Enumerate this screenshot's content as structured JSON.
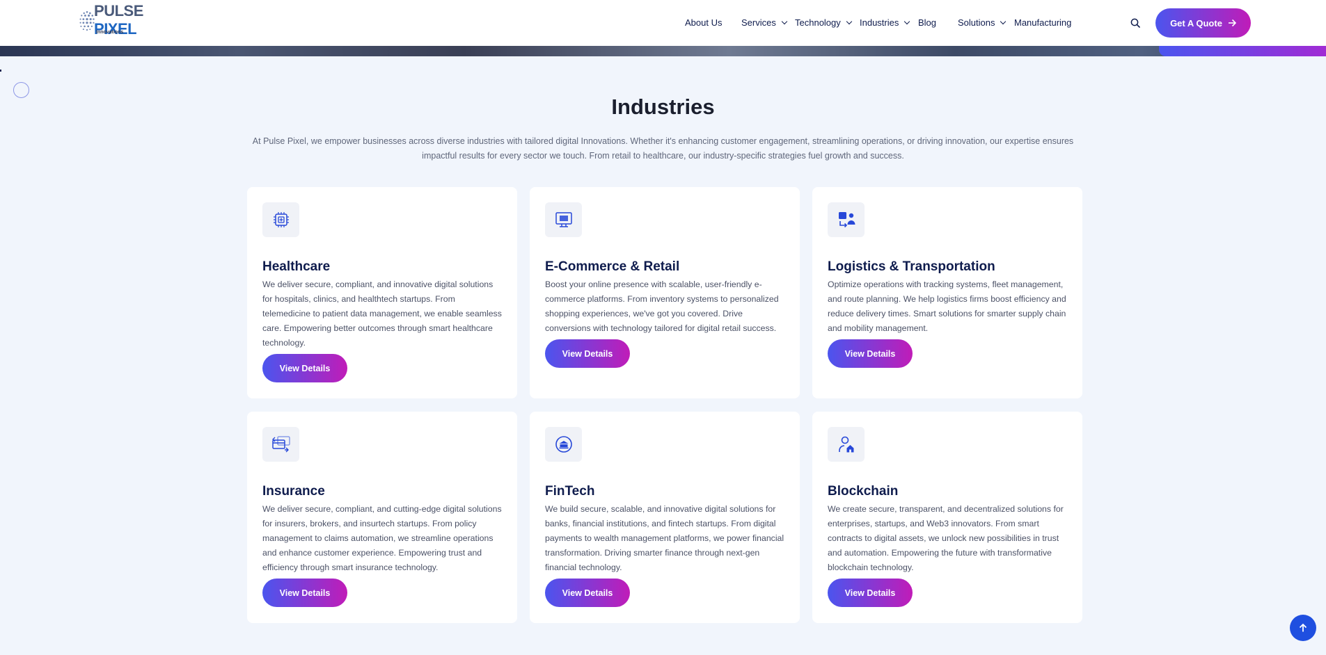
{
  "header": {
    "logo": {
      "name_part1": "PULSE",
      "name_part2": "PIXEL",
      "tagline": "Innovations"
    },
    "nav": [
      {
        "label": "About Us",
        "dropdown": false
      },
      {
        "label": "Services",
        "dropdown": true
      },
      {
        "label": "Technology",
        "dropdown": true
      },
      {
        "label": "Industries",
        "dropdown": true
      },
      {
        "label": "Blog",
        "dropdown": false
      },
      {
        "label": "Solutions",
        "dropdown": true
      },
      {
        "label": "Manufacturing",
        "dropdown": false
      }
    ],
    "search_icon": "search-icon",
    "quote_button": "Get A Quote"
  },
  "section": {
    "title": "Industries",
    "description": "At Pulse Pixel, we empower businesses across diverse industries with tailored digital Innovations. Whether it's enhancing customer engagement, streamlining operations, or driving innovation, our expertise ensures impactful results for every sector we touch. From retail to healthcare, our industry-specific strategies fuel growth and success."
  },
  "cards": [
    {
      "title": "Healthcare",
      "icon": "medical-chip-icon",
      "description": "We deliver secure, compliant, and innovative digital solutions for hospitals, clinics, and healthtech startups. From telemedicine to patient data management, we enable seamless care. Empowering better outcomes through smart healthcare technology.",
      "button": "View Details"
    },
    {
      "title": "E-Commerce & Retail",
      "icon": "monitor-store-icon",
      "description": "Boost your online presence with scalable, user-friendly e-commerce platforms. From inventory systems to personalized shopping experiences, we've got you covered. Drive conversions with technology tailored for digital retail success.",
      "button": "View Details"
    },
    {
      "title": "Logistics & Transportation",
      "icon": "delivery-person-icon",
      "description": "Optimize operations with tracking systems, fleet management, and route planning. We help logistics firms boost efficiency and reduce delivery times. Smart solutions for smarter supply chain and mobility management.",
      "button": "View Details"
    },
    {
      "title": "Insurance",
      "icon": "card-exchange-icon",
      "description": "We deliver secure, compliant, and cutting-edge digital solutions for insurers, brokers, and insurtech startups. From policy management to claims automation, we streamline operations and enhance customer experience. Empowering trust and efficiency through smart insurance technology.",
      "button": "View Details"
    },
    {
      "title": "FinTech",
      "icon": "coin-bank-icon",
      "description": "We build secure, scalable, and innovative digital solutions for banks, financial institutions, and fintech startups. From digital payments to wealth management platforms, we power financial transformation. Driving smarter finance through next-gen financial technology.",
      "button": "View Details"
    },
    {
      "title": "Blockchain",
      "icon": "user-home-icon",
      "description": "We create secure, transparent, and decentralized solutions for enterprises, startups, and Web3 innovators. From smart contracts to digital assets, we unlock new possibilities in trust and automation. Empowering the future with transformative blockchain technology.",
      "button": "View Details"
    }
  ],
  "scroll_top_icon": "arrow-up-icon",
  "colors": {
    "accent_start": "#4b55ee",
    "accent_end": "#c01cb8",
    "icon_blue": "#2748d8",
    "heading": "#0f1c4d"
  }
}
